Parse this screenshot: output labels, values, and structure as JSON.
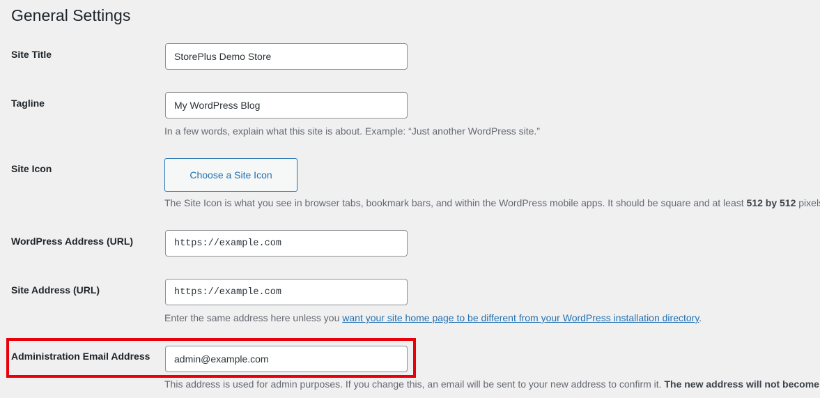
{
  "page": {
    "title": "General Settings"
  },
  "fields": {
    "site_title": {
      "label": "Site Title",
      "value": "StorePlus Demo Store"
    },
    "tagline": {
      "label": "Tagline",
      "value": "My WordPress Blog",
      "description": "In a few words, explain what this site is about. Example: “Just another WordPress site.”"
    },
    "site_icon": {
      "label": "Site Icon",
      "button_label": "Choose a Site Icon",
      "description_prefix": "The Site Icon is what you see in browser tabs, bookmark bars, and within the WordPress mobile apps. It should be square and at least",
      "description_bold_1": "512",
      "description_by": "by",
      "description_bold_2": "512",
      "description_suffix": "pixels."
    },
    "wordpress_address": {
      "label": "WordPress Address (URL)",
      "value": "https://example.com"
    },
    "site_address": {
      "label": "Site Address (URL)",
      "value": "https://example.com",
      "description_prefix": "Enter the same address here unless you",
      "description_link": "want your site home page to be different from your WordPress installation directory",
      "description_suffix": "."
    },
    "admin_email": {
      "label": "Administration Email Address",
      "value": "admin@example.com",
      "description_prefix": "This address is used for admin purposes. If you change this, an email will be sent to your new address to confirm it.",
      "description_bold": "The new address will not become ac"
    }
  },
  "colors": {
    "accent": "#2271b1",
    "highlight": "#e8000b",
    "background": "#f0f0f1"
  }
}
